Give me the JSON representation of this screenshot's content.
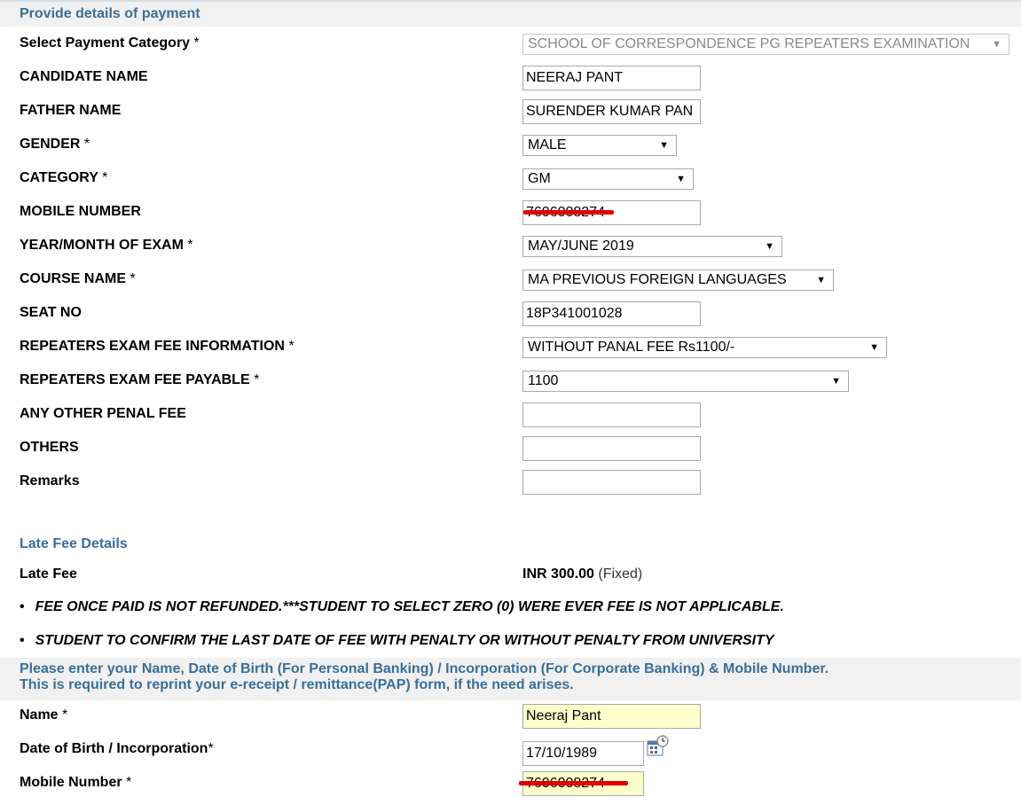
{
  "header": {
    "title": "Provide details of payment"
  },
  "form": {
    "payment_category": {
      "label": "Select Payment Category",
      "required": "*",
      "value": "SCHOOL OF CORRESPONDENCE PG REPEATERS EXAMINATION"
    },
    "candidate_name": {
      "label": "CANDIDATE NAME",
      "value": "NEERAJ PANT"
    },
    "father_name": {
      "label": "FATHER NAME",
      "value": "SURENDER KUMAR PAN"
    },
    "gender": {
      "label": "GENDER",
      "required": "*",
      "value": "MALE"
    },
    "category": {
      "label": "CATEGORY",
      "required": "*",
      "value": "GM"
    },
    "mobile_number": {
      "label": "MOBILE NUMBER",
      "value": "7606008274"
    },
    "year_month": {
      "label": "YEAR/MONTH OF EXAM",
      "required": "*",
      "value": "MAY/JUNE 2019"
    },
    "course_name": {
      "label": "COURSE NAME",
      "required": "*",
      "value": "MA PREVIOUS FOREIGN LANGUAGES"
    },
    "seat_no": {
      "label": "SEAT NO",
      "value": "18P341001028"
    },
    "fee_info": {
      "label": "REPEATERS EXAM FEE INFORMATION",
      "required": "*",
      "value": "WITHOUT PANAL FEE Rs1100/-"
    },
    "fee_payable": {
      "label": "REPEATERS EXAM FEE PAYABLE",
      "required": "*",
      "value": "1100"
    },
    "penal_fee": {
      "label": "ANY OTHER PENAL FEE",
      "value": ""
    },
    "others": {
      "label": "OTHERS",
      "value": ""
    },
    "remarks": {
      "label": "Remarks",
      "value": ""
    }
  },
  "late_fee": {
    "heading": "Late Fee Details",
    "label": "Late Fee",
    "amount": "INR 300.00",
    "note": "(Fixed)"
  },
  "notices": [
    "FEE ONCE PAID IS NOT REFUNDED.***STUDENT TO SELECT ZERO (0) WERE EVER FEE IS NOT APPLICABLE.",
    "STUDENT TO CONFIRM THE LAST DATE OF FEE WITH PENALTY OR WITHOUT PENALTY FROM UNIVERSITY"
  ],
  "personal": {
    "header_line1": "Please enter your Name, Date of Birth (For Personal Banking) / Incorporation (For Corporate Banking)  & Mobile Number.",
    "header_line2": "This is required to reprint your e-receipt / remittance(PAP) form, if the need arises.",
    "name": {
      "label": "Name",
      "required": "*",
      "value": "Neeraj Pant"
    },
    "dob": {
      "label": "Date of Birth / Incorporation",
      "required": "*",
      "value": "17/10/1989"
    },
    "mobile": {
      "label": "Mobile Number",
      "required": "*",
      "value": "7606008274"
    }
  },
  "colors": {
    "header_text": "#3a6f9a",
    "header_bg": "#f1f1f1",
    "highlight_field": "#ffffcc",
    "redaction": "#e00000"
  }
}
